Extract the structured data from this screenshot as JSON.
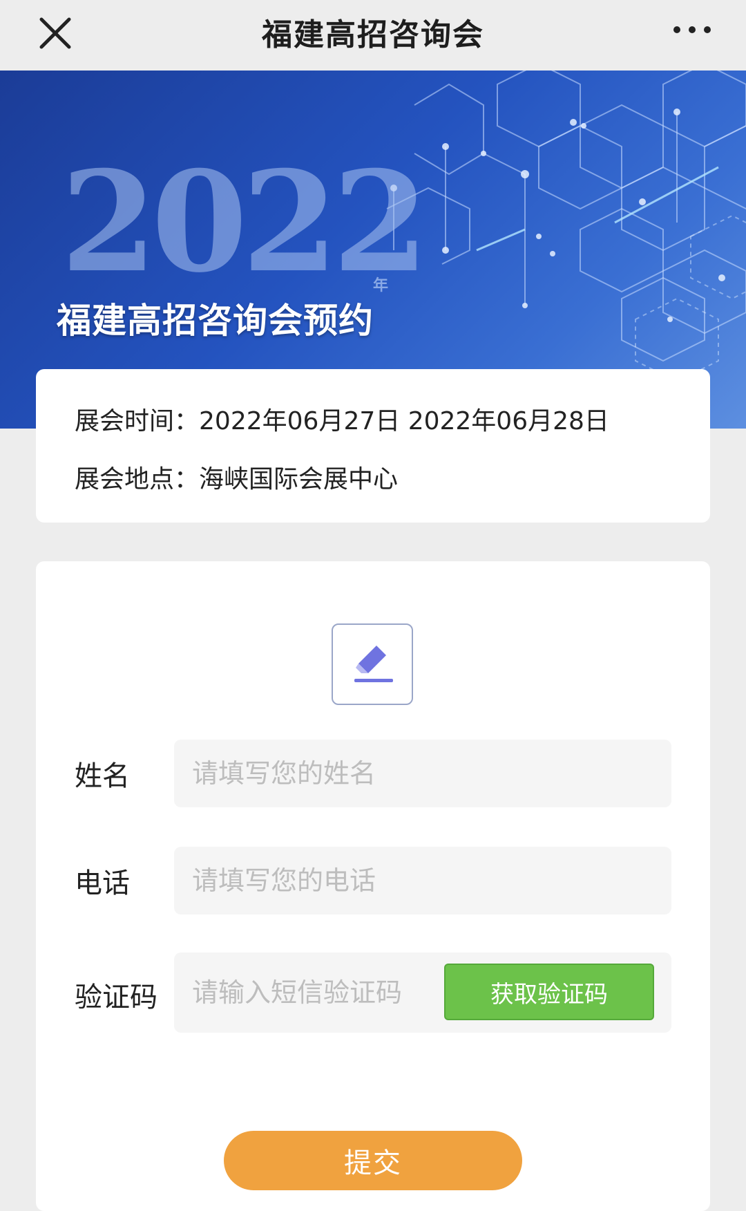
{
  "nav": {
    "title": "福建高招咨询会"
  },
  "banner": {
    "year": "2022",
    "year_suffix": "年",
    "title": "福建高招咨询会预约"
  },
  "info": {
    "time_label": "展会时间：",
    "time_value": "2022年06月27日 2022年06月28日",
    "place_label": "展会地点：",
    "place_value": "海峡国际会展中心"
  },
  "form": {
    "name_label": "姓名",
    "name_placeholder": "请填写您的姓名",
    "phone_label": "电话",
    "phone_placeholder": "请填写您的电话",
    "code_label": "验证码",
    "code_placeholder": "请输入短信验证码",
    "get_code_label": "获取验证码",
    "submit_label": "提交"
  },
  "colors": {
    "get_code_button": "#6cc24a",
    "submit_button": "#f0a23f",
    "banner_blue": "#2453bf"
  }
}
